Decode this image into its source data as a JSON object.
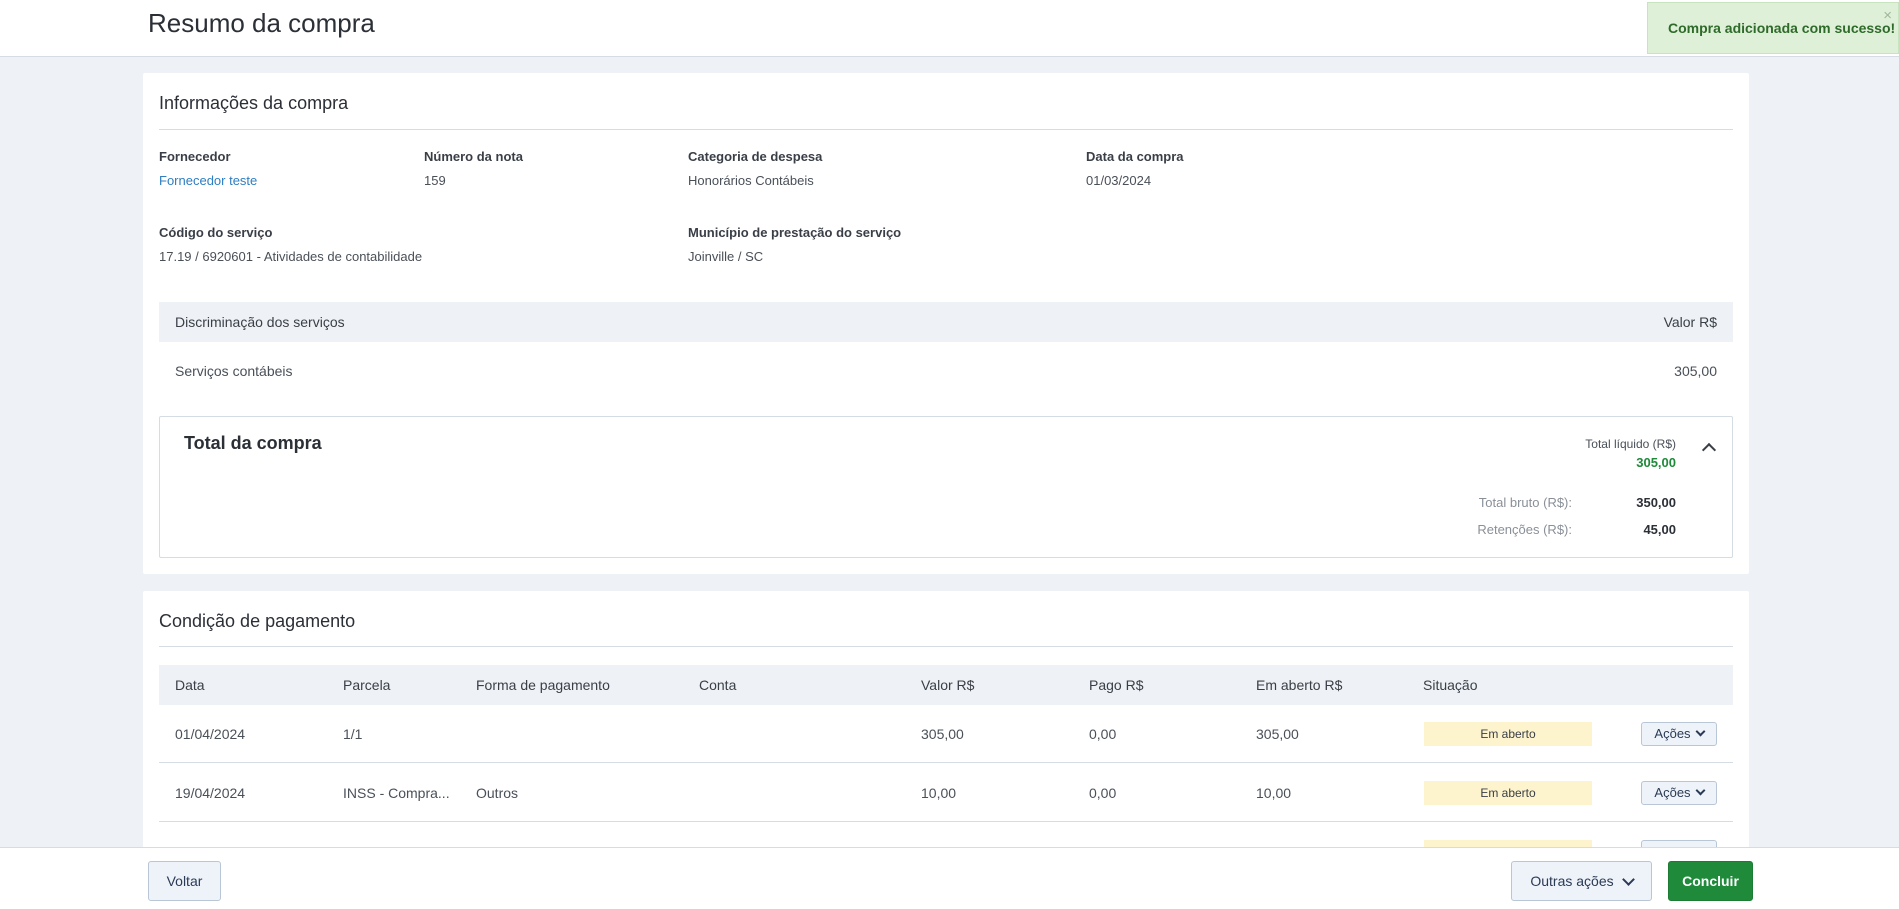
{
  "header": {
    "title": "Resumo da compra"
  },
  "toast": {
    "message": "Compra adicionada com sucesso!",
    "close": "×"
  },
  "info": {
    "title": "Informações da compra",
    "fornecedor": {
      "label": "Fornecedor",
      "value": "Fornecedor teste"
    },
    "numero_nota": {
      "label": "Número da nota",
      "value": "159"
    },
    "categoria": {
      "label": "Categoria de despesa",
      "value": "Honorários Contábeis"
    },
    "data_compra": {
      "label": "Data da compra",
      "value": "01/03/2024"
    },
    "codigo_servico": {
      "label": "Código do serviço",
      "value": "17.19 / 6920601 - Atividades de contabilidade"
    },
    "municipio": {
      "label": "Município de prestação do serviço",
      "value": "Joinville / SC"
    }
  },
  "services": {
    "header_desc": "Discriminação dos serviços",
    "header_value": "Valor R$",
    "rows": [
      {
        "desc": "Serviços contábeis",
        "value": "305,00"
      }
    ]
  },
  "total": {
    "title": "Total da compra",
    "liquido_label": "Total líquido (R$)",
    "liquido_value": "305,00",
    "bruto_label": "Total bruto (R$):",
    "bruto_value": "350,00",
    "retencoes_label": "Retenções (R$):",
    "retencoes_value": "45,00"
  },
  "payment": {
    "title": "Condição de pagamento",
    "columns": [
      "Data",
      "Parcela",
      "Forma de pagamento",
      "Conta",
      "Valor R$",
      "Pago R$",
      "Em aberto R$",
      "Situação"
    ],
    "rows": [
      {
        "data": "01/04/2024",
        "parcela": "1/1",
        "forma": "",
        "conta": "",
        "valor": "305,00",
        "pago": "0,00",
        "aberto": "305,00",
        "situacao": "Em aberto",
        "acoes": "Ações"
      },
      {
        "data": "19/04/2024",
        "parcela": "INSS - Compra...",
        "forma": "Outros",
        "conta": "",
        "valor": "10,00",
        "pago": "0,00",
        "aberto": "10,00",
        "situacao": "Em aberto",
        "acoes": "Ações"
      },
      {
        "data": "",
        "parcela": "",
        "forma": "",
        "conta": "",
        "valor": "",
        "pago": "",
        "aberto": "",
        "situacao": "",
        "acoes": ""
      }
    ]
  },
  "footer": {
    "back": "Voltar",
    "more": "Outras ações",
    "finish": "Concluir"
  },
  "colors": {
    "accent_green": "#1e8a3a",
    "link_blue": "#2f7ec1",
    "status_bg": "#fdf3cc"
  }
}
